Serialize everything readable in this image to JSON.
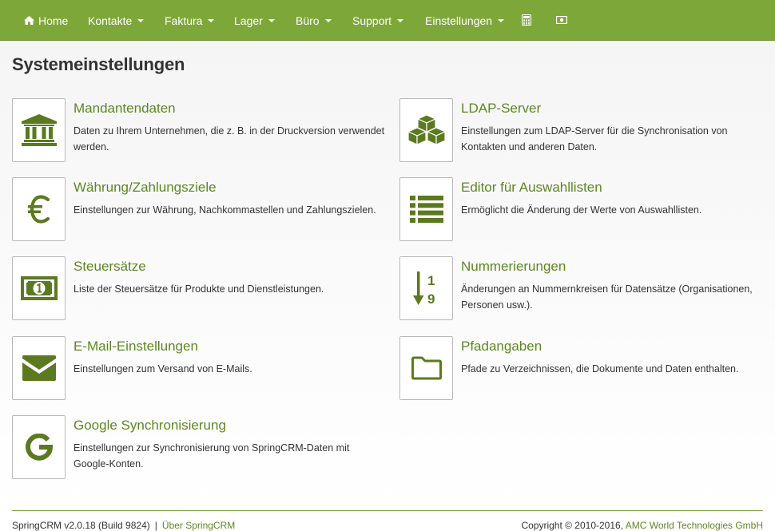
{
  "nav": {
    "home": "Home",
    "items": [
      "Kontakte",
      "Faktura",
      "Lager",
      "Büro",
      "Support",
      "Einstellungen"
    ],
    "icons": [
      "calculator-icon",
      "money-icon"
    ]
  },
  "page": {
    "title": "Systemeinstellungen"
  },
  "entries": [
    {
      "title": "Mandantendaten",
      "desc": "Daten zu Ihrem Unternehmen, die z. B. in der Druckversion verwendet werden.",
      "icon": "bank-icon"
    },
    {
      "title": "LDAP-Server",
      "desc": "Einstellungen zum LDAP-Server für die Synchronisation von Kontakten und anderen Daten.",
      "icon": "cubes-icon"
    },
    {
      "title": "Währung/Zahlungsziele",
      "desc": "Einstellungen zur Währung, Nachkommastellen und Zahlungszielen.",
      "icon": "euro-icon"
    },
    {
      "title": "Editor für Auswahllisten",
      "desc": "Ermöglicht die Änderung der Werte von Auswahllisten.",
      "icon": "list-icon"
    },
    {
      "title": "Steuersätze",
      "desc": "Liste der Steuersätze für Produkte und Dienstleistungen.",
      "icon": "money-icon"
    },
    {
      "title": "Nummerierungen",
      "desc": "Änderungen an Nummernkreisen für Datensätze (Organisationen, Personen usw.).",
      "icon": "sort-numeric-icon"
    },
    {
      "title": "E-Mail-Einstellungen",
      "desc": "Einstellungen zum Versand von E-Mails.",
      "icon": "envelope-icon"
    },
    {
      "title": "Pfadangaben",
      "desc": "Pfade zu Verzeichnissen, die Dokumente und Daten enthalten.",
      "icon": "folder-icon"
    },
    {
      "title": "Google Synchronisierung",
      "desc": "Einstellungen zur Synchronisierung von SpringCRM-Daten mit Google-Konten.",
      "icon": "google-icon"
    }
  ],
  "footer": {
    "version": "SpringCRM v2.0.18 (Build 9824)",
    "separator": "|",
    "about": "Über SpringCRM",
    "copyright": "Copyright © 2010-2016,",
    "company": "AMC World Technologies GmbH"
  },
  "colors": {
    "navbar": "#7ea73a",
    "accent": "#5e8722",
    "icon": "#5b7a1f"
  }
}
